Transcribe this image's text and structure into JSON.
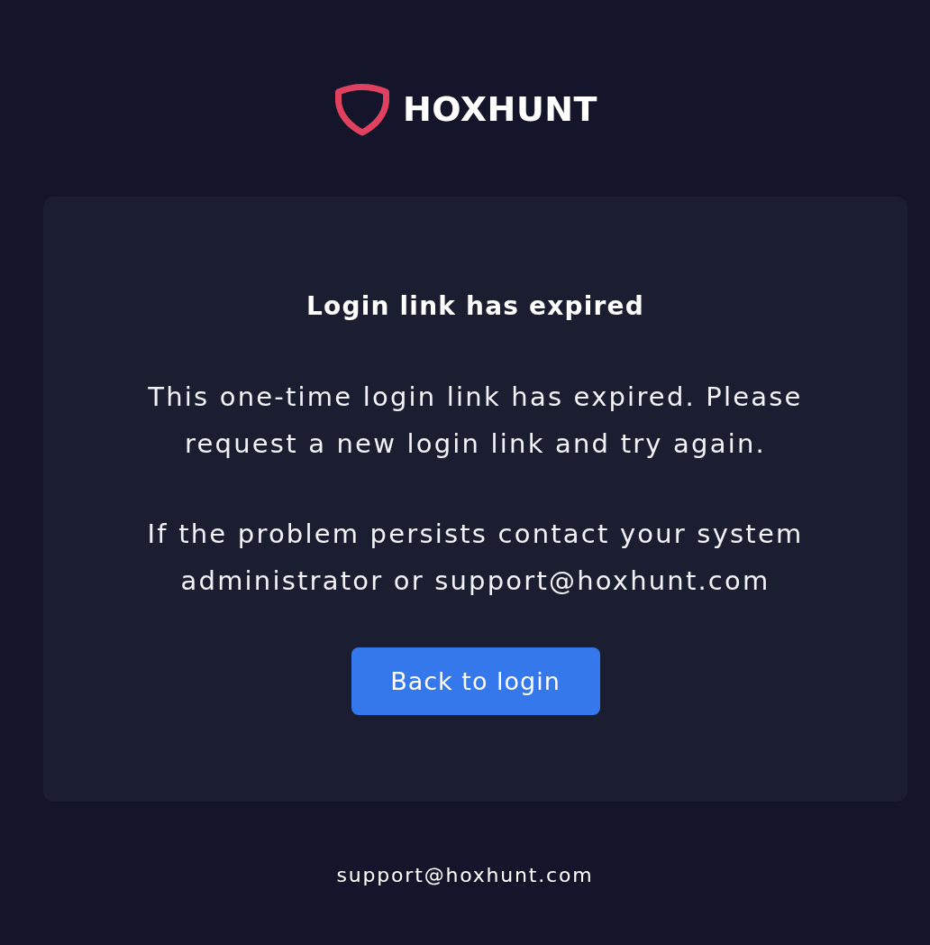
{
  "logo": {
    "wordmark": "HOXHUNT"
  },
  "card": {
    "title": "Login link has expired",
    "paragraphs": [
      "This one-time login link has expired. Please request a new login link and try again.",
      "If the problem persists contact your system administrator or support@hoxhunt.com"
    ],
    "button": "Back to login"
  },
  "footer": {
    "email": "support@hoxhunt.com"
  }
}
